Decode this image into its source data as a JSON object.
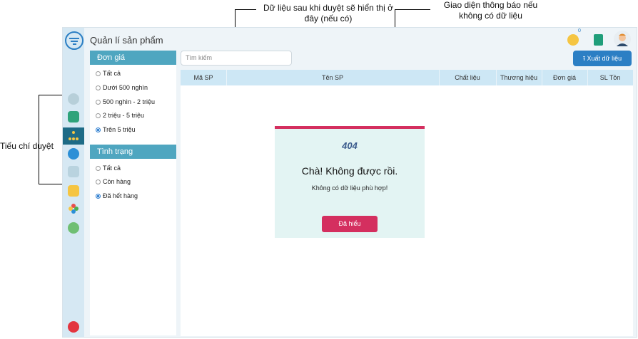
{
  "annotations": {
    "data_note": "Dữ liệu sau khi duyệt sẽ hiển thị ở đây (nếu có)",
    "empty_note": "Giao diện thông báo nếu không có dữ liệu",
    "filter_note": "Tiếu chí duyệt"
  },
  "app": {
    "title": "Quản lí sản phẩm",
    "notification_count": "0"
  },
  "filters": {
    "price": {
      "heading": "Đơn giá",
      "options": [
        "Tất cả",
        "Dưới 500 nghìn",
        "500 nghìn - 2 triệu",
        "2 triệu - 5 triệu",
        "Trên 5 triệu"
      ],
      "selected": "Trên 5 triệu"
    },
    "status": {
      "heading": "Tình trạng",
      "options": [
        "Tất cả",
        "Còn hàng",
        "Đã hết hàng"
      ],
      "selected": "Đã hết hàng"
    }
  },
  "search": {
    "placeholder": "Tìm kiếm"
  },
  "toolbar": {
    "export_label": "Xuất dữ liệu"
  },
  "table": {
    "columns": [
      "Mã SP",
      "Tên SP",
      "Chất liệu",
      "Thương hiệu",
      "Đơn giá",
      "SL Tồn"
    ]
  },
  "dialog": {
    "code": "404",
    "title": "Chà! Không được rồi.",
    "message": "Không có dữ liệu phù hợp!",
    "button": "Đã hiểu"
  },
  "colors": {
    "accent": "#4fa6c0",
    "primary_button": "#2c7fc4",
    "danger": "#d42f5f",
    "dialog_bg": "#e3f4f3"
  }
}
